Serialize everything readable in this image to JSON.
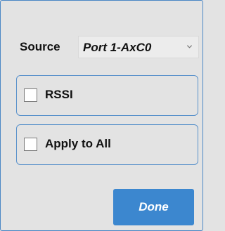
{
  "source": {
    "label": "Source",
    "selected": "Port 1-AxC0",
    "dropdown_icon": "chevron-down-icon"
  },
  "options": {
    "rssi": {
      "label": "RSSI",
      "checked": false
    },
    "apply_to_all": {
      "label": "Apply to All",
      "checked": false
    }
  },
  "actions": {
    "done_label": "Done"
  },
  "colors": {
    "background": "#e3e3e3",
    "accent": "#3c87cf",
    "border": "#5a92cb"
  }
}
